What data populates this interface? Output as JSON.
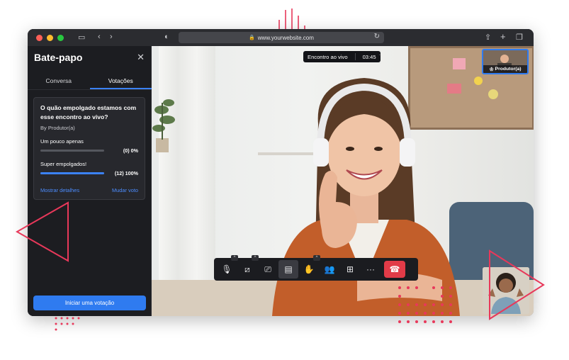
{
  "browser": {
    "url": "www.yourwebsite.com"
  },
  "sidebar": {
    "title": "Bate-papo",
    "tabs": [
      "Conversa",
      "Votações"
    ],
    "active_tab": "Votações",
    "poll": {
      "question": "O quão empolgado estamos com esse encontro ao vivo?",
      "author": "By Produtor(a)",
      "options": [
        {
          "label": "Um pouco apenas",
          "result": "(0) 0%",
          "fraction": 0.0
        },
        {
          "label": "Super empolgados!",
          "result": "(12) 100%",
          "fraction": 1.0
        }
      ],
      "show_details": "Mostrar detalhes",
      "change_vote": "Mudar voto"
    },
    "start_poll_button": "Iniciar uma votação"
  },
  "meeting": {
    "live_label": "Encontro ao vivo",
    "timer": "03:45",
    "presenter_tile_label": "Produtor(a)"
  },
  "toolbar": {
    "buttons": [
      "microphone-icon",
      "camera-icon",
      "share-screen-icon",
      "chat-icon",
      "raise-hand-icon",
      "participants-icon",
      "layout-grid-icon",
      "more-icon",
      "hang-up-icon"
    ]
  },
  "colors": {
    "accent_blue": "#2f7bf0",
    "hangup_red": "#e23b48",
    "decor_pink": "#e8385a",
    "panel_bg": "#1c1d21"
  }
}
